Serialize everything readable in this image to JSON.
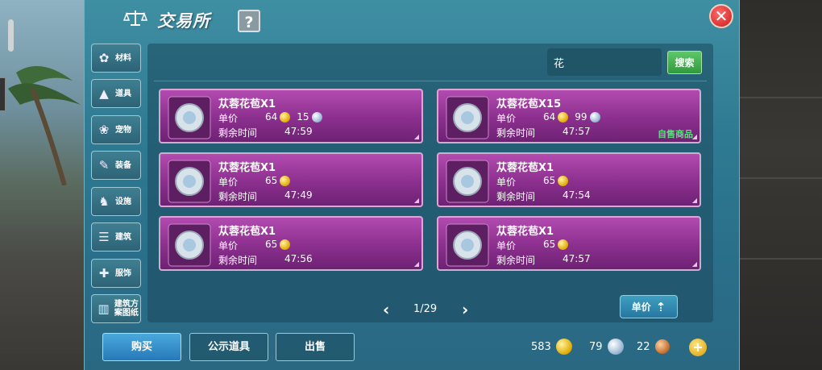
{
  "window": {
    "title": "交易所",
    "help_label": "?",
    "close_label": "✕"
  },
  "sidebar": {
    "items": [
      {
        "label": "材料",
        "icon": "materials-icon",
        "glyph": "✿"
      },
      {
        "label": "道具",
        "icon": "item-icon",
        "glyph": "▲"
      },
      {
        "label": "宠物",
        "icon": "pet-paw-icon",
        "glyph": "❀"
      },
      {
        "label": "装备",
        "icon": "equipment-icon",
        "glyph": "✎"
      },
      {
        "label": "设施",
        "icon": "facility-icon",
        "glyph": "♞"
      },
      {
        "label": "建筑",
        "icon": "building-icon",
        "glyph": "☰"
      },
      {
        "label": "服饰",
        "icon": "clothing-icon",
        "glyph": "✚"
      },
      {
        "label": "建筑方案图纸",
        "icon": "blueprint-icon",
        "glyph": "▥"
      }
    ]
  },
  "search": {
    "value": "花",
    "button_label": "搜索"
  },
  "listings": [
    {
      "name": "苁蓉花苞X1",
      "price_label": "单价",
      "gold": "64",
      "silver": "15",
      "time_label": "剩余时间",
      "time": "47:59",
      "own_label": ""
    },
    {
      "name": "苁蓉花苞X15",
      "price_label": "单价",
      "gold": "64",
      "silver": "99",
      "time_label": "剩余时间",
      "time": "47:57",
      "own_label": "自售商品"
    },
    {
      "name": "苁蓉花苞X1",
      "price_label": "单价",
      "gold": "65",
      "silver": "",
      "time_label": "剩余时间",
      "time": "47:49",
      "own_label": ""
    },
    {
      "name": "苁蓉花苞X1",
      "price_label": "单价",
      "gold": "65",
      "silver": "",
      "time_label": "剩余时间",
      "time": "47:54",
      "own_label": ""
    },
    {
      "name": "苁蓉花苞X1",
      "price_label": "单价",
      "gold": "65",
      "silver": "",
      "time_label": "剩余时间",
      "time": "47:56",
      "own_label": ""
    },
    {
      "name": "苁蓉花苞X1",
      "price_label": "单价",
      "gold": "65",
      "silver": "",
      "time_label": "剩余时间",
      "time": "47:57",
      "own_label": ""
    }
  ],
  "pager": {
    "prev": "‹",
    "next": "›",
    "text": "1/29"
  },
  "sort": {
    "label": "单价",
    "arrow": "⇡"
  },
  "bottom": {
    "buy": "购买",
    "showcase": "公示道具",
    "sell": "出售"
  },
  "wallet": {
    "gold": "583",
    "silver": "79",
    "copper": "22",
    "add": "+"
  },
  "colors": {
    "accent": "#2f7b93",
    "card": "#8b2f8e",
    "own_label": "#58e07a",
    "buy_button": "#2679b8"
  }
}
